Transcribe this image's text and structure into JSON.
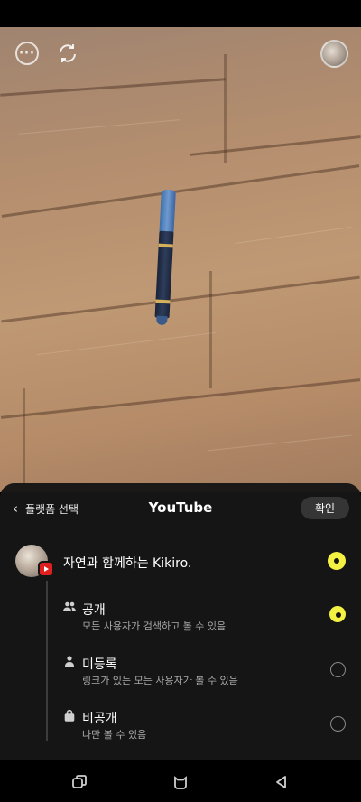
{
  "camera": {
    "more_icon": "more-dots-icon",
    "switch_icon": "switch-camera-icon",
    "profile": "channel-avatar"
  },
  "sheet": {
    "back_label": "플랫폼 선택",
    "title": "YouTube",
    "confirm_label": "확인",
    "channel": {
      "name": "자연과 함께하는 Kikiro.",
      "badge_icon": "youtube-icon",
      "selected": true
    },
    "options": [
      {
        "icon": "people-icon",
        "label": "공개",
        "desc": "모든 사용자가 검색하고 볼 수 있음",
        "selected": true
      },
      {
        "icon": "person-icon",
        "label": "미등록",
        "desc": "링크가 있는 모든 사용자가 볼 수 있음",
        "selected": false
      },
      {
        "icon": "lock-icon",
        "label": "비공개",
        "desc": "나만 볼 수 있음",
        "selected": false
      }
    ]
  },
  "nav": {
    "recent": "recent-apps-icon",
    "home": "home-icon",
    "back": "back-icon"
  },
  "colors": {
    "accent": "#f3f242",
    "sheet_bg": "#161616",
    "youtube_red": "#e02020"
  }
}
